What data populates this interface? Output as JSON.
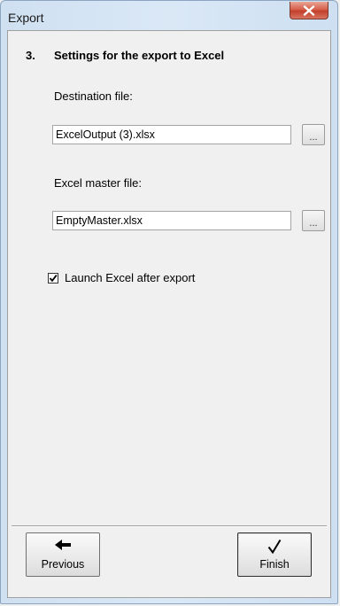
{
  "window": {
    "title": "Export",
    "close_label": "×"
  },
  "step": {
    "number": "3.",
    "title": "Settings for the export to Excel"
  },
  "destination": {
    "label": "Destination file:",
    "value": "ExcelOutput (3).xlsx",
    "browse_label": "..."
  },
  "master": {
    "label": "Excel master file:",
    "value": "EmptyMaster.xlsx",
    "browse_label": "..."
  },
  "launch_excel": {
    "label": "Launch Excel after export",
    "checked": true
  },
  "buttons": {
    "previous_label": "Previous",
    "finish_label": "Finish"
  },
  "icons": {
    "close": "close-icon",
    "checkmark": "checkmark-icon",
    "previous": "arrow-left-icon",
    "finish": "check-icon"
  }
}
